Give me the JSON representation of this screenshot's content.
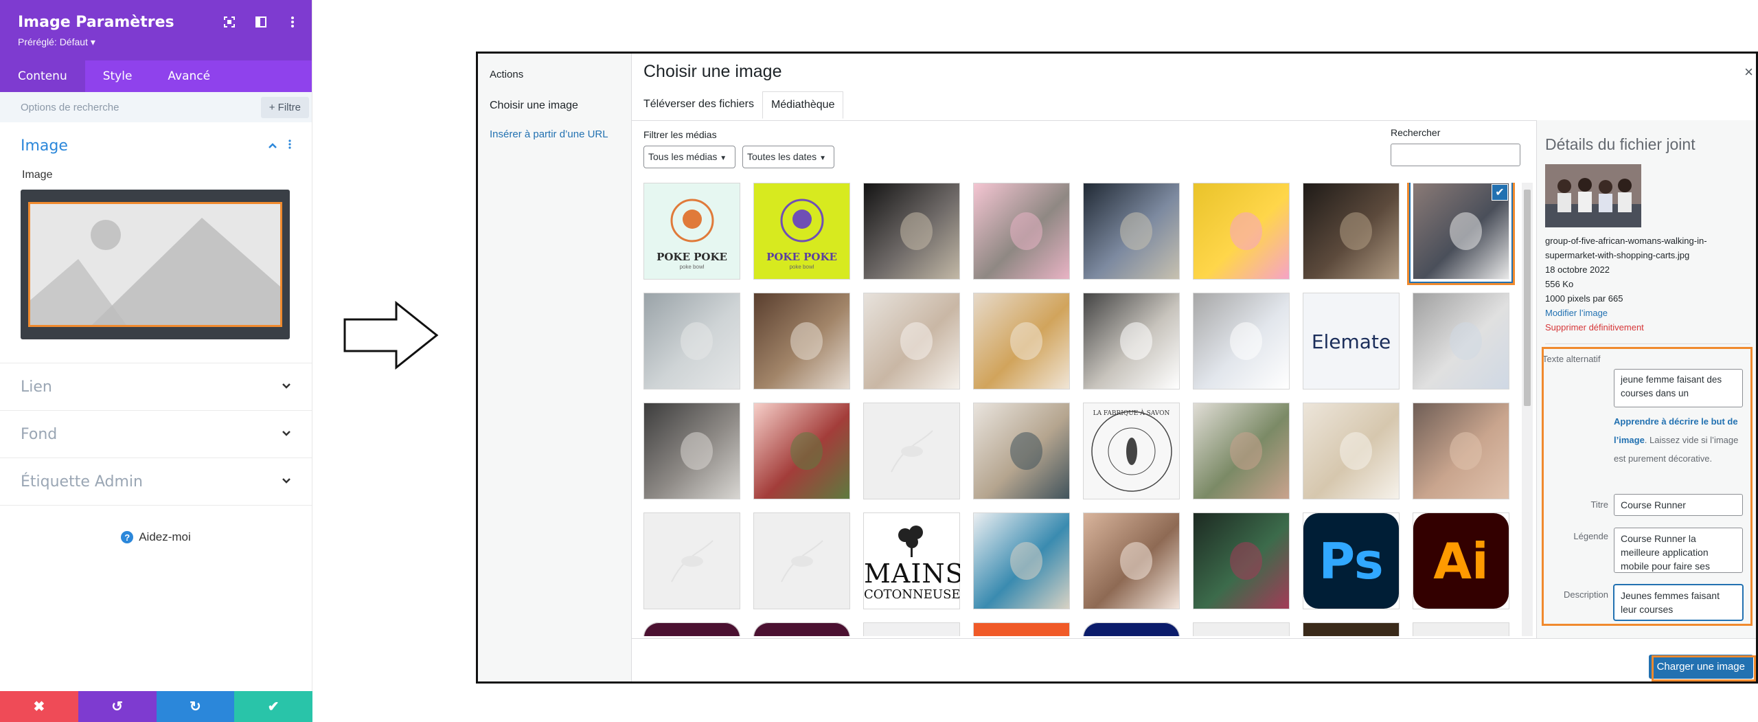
{
  "divi_panel": {
    "title": "Image Paramètres",
    "preset": "Préréglé: Défaut ▾",
    "tabs": [
      "Contenu",
      "Style",
      "Avancé"
    ],
    "search_placeholder": "Options de recherche",
    "filter_label": "+ Filtre",
    "image_section": {
      "title": "Image",
      "field_label": "Image"
    },
    "sections": [
      "Lien",
      "Fond",
      "Étiquette Admin"
    ],
    "help": "Aidez-moi",
    "header_icons": [
      "focus-icon",
      "layout-icon",
      "more-icon"
    ],
    "footer_buttons": [
      {
        "name": "close",
        "glyph": "✖",
        "color": "#ef4b57"
      },
      {
        "name": "undo",
        "glyph": "↺",
        "color": "#7e3bd0"
      },
      {
        "name": "redo",
        "glyph": "↻",
        "color": "#2b87da"
      },
      {
        "name": "save",
        "glyph": "✔",
        "color": "#29c4a9"
      }
    ],
    "colors": {
      "header": "#7e3bd0",
      "tabs": "#8f42ec",
      "accent": "#2b87da",
      "highlight": "#f08a2e"
    }
  },
  "modal": {
    "menu": {
      "header": "Actions",
      "current": "Choisir une image",
      "link": "Insérer à partir d’une URL"
    },
    "title": "Choisir une image",
    "close_glyph": "×",
    "tabs": [
      "Téléverser des fichiers",
      "Médiathèque"
    ],
    "filter_label": "Filtrer les médias",
    "filter_media": "Tous les médias",
    "filter_dates": "Toutes les dates",
    "search_label": "Rechercher",
    "thumbnails": [
      {
        "kind": "logo",
        "text": "POKE POKE",
        "sub": "poke bowl"
      },
      {
        "kind": "logo-green",
        "text": "POKE POKE",
        "sub": "poke bowl"
      },
      {
        "kind": "photo"
      },
      {
        "kind": "photo"
      },
      {
        "kind": "photo"
      },
      {
        "kind": "photo"
      },
      {
        "kind": "photo"
      },
      {
        "kind": "photo",
        "selected": true
      },
      {
        "kind": "photo"
      },
      {
        "kind": "photo"
      },
      {
        "kind": "photo"
      },
      {
        "kind": "photo"
      },
      {
        "kind": "photo"
      },
      {
        "kind": "photo"
      },
      {
        "kind": "text",
        "text": "Elemate"
      },
      {
        "kind": "photo"
      },
      {
        "kind": "photo"
      },
      {
        "kind": "photo"
      },
      {
        "kind": "light"
      },
      {
        "kind": "photo"
      },
      {
        "kind": "seal",
        "text": "LA FABRIQUE À SAVON"
      },
      {
        "kind": "photo"
      },
      {
        "kind": "photo"
      },
      {
        "kind": "photo"
      },
      {
        "kind": "light"
      },
      {
        "kind": "light"
      },
      {
        "kind": "text-dark",
        "text": "MAINS",
        "sub": "COTONNEUSE"
      },
      {
        "kind": "photo"
      },
      {
        "kind": "photo"
      },
      {
        "kind": "photo"
      },
      {
        "kind": "ps",
        "text": "Ps"
      },
      {
        "kind": "ai",
        "text": "Ai"
      }
    ],
    "details": {
      "title": "Détails du fichier joint",
      "filename": "group-of-five-african-womans-walking-in-supermarket-with-shopping-carts.jpg",
      "date": "18 octobre 2022",
      "size": "556 Ko",
      "dimensions": "1000 pixels par 665",
      "edit_link": "Modifier l’image",
      "delete_link": "Supprimer définitivement",
      "alt_label": "Texte alternatif",
      "alt_value": "jeune femme faisant des courses dans un",
      "help_link": "Apprendre à décrire le but de l’image",
      "help_rest": ". Laissez vide si l’image est purement décorative.",
      "title_label": "Titre",
      "title_value": "Course Runner",
      "caption_label": "Légende",
      "caption_value": "Course Runner la meilleure application mobile pour faire ses",
      "description_label": "Description",
      "description_value": "Jeunes femmes faisant leur courses"
    },
    "upload_button": "Charger une image"
  }
}
